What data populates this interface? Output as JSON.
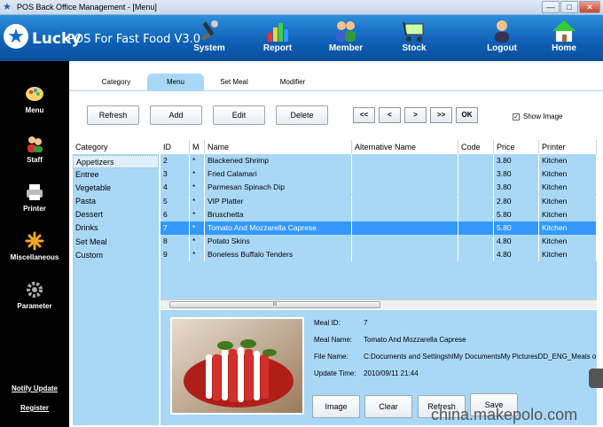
{
  "window": {
    "title": "POS Back Office Management - [Menu]"
  },
  "brand": {
    "name": "Lucky",
    "subtitle": "POS For Fast Food V3.0"
  },
  "nav": {
    "items": [
      {
        "label": "System",
        "icon": "system-icon"
      },
      {
        "label": "Report",
        "icon": "report-chart-icon"
      },
      {
        "label": "Member",
        "icon": "member-icon"
      },
      {
        "label": "Stock",
        "icon": "stock-cart-icon"
      },
      {
        "label": "Logout",
        "icon": "logout-icon"
      },
      {
        "label": "Home",
        "icon": "home-icon"
      }
    ]
  },
  "sidebar": {
    "items": [
      {
        "label": "Menu",
        "icon": "palette-icon"
      },
      {
        "label": "Staff",
        "icon": "staff-icon"
      },
      {
        "label": "Printer",
        "icon": "printer-icon"
      },
      {
        "label": "Miscellaneous",
        "icon": "misc-icon"
      },
      {
        "label": "Parameter",
        "icon": "gear-icon"
      }
    ],
    "links": {
      "notify": "Notify Update",
      "register": "Register"
    }
  },
  "tabs": [
    "Category",
    "Menu",
    "Set Meal",
    "Modifier"
  ],
  "active_tab": "Menu",
  "toolbar": {
    "refresh": "Refresh",
    "add": "Add",
    "edit": "Edit",
    "delete": "Delete",
    "first": "<<",
    "prev": "<",
    "next": ">",
    "last": ">>",
    "ok": "OK",
    "show_image": "Show Image"
  },
  "category": {
    "header": "Category",
    "items": [
      "Appetizers",
      "Entree",
      "Vegetable",
      "Pasta",
      "Dessert",
      "Drinks",
      "Set Meal",
      "Custom"
    ],
    "selected": "Appetizers"
  },
  "grid": {
    "columns": [
      "ID",
      "M",
      "Name",
      "Alternative Name",
      "Code",
      "Price",
      "Printer"
    ],
    "rows": [
      {
        "id": "2",
        "m": "*",
        "name": "Blackened Shrimp",
        "alt": "",
        "code": "",
        "price": "3.80",
        "printer": "Kitchen"
      },
      {
        "id": "3",
        "m": "*",
        "name": "Fried Calamari",
        "alt": "",
        "code": "",
        "price": "3.80",
        "printer": "Kitchen"
      },
      {
        "id": "4",
        "m": "*",
        "name": "Parmesan Spinach Dip",
        "alt": "",
        "code": "",
        "price": "3.80",
        "printer": "Kitchen"
      },
      {
        "id": "5",
        "m": "*",
        "name": "VIP Platter",
        "alt": "",
        "code": "",
        "price": "2.80",
        "printer": "Kitchen"
      },
      {
        "id": "6",
        "m": "*",
        "name": "Bruschetta",
        "alt": "",
        "code": "",
        "price": "5.80",
        "printer": "Kitchen"
      },
      {
        "id": "7",
        "m": "*",
        "name": "Tomato And Mozzarella Caprese",
        "alt": "",
        "code": "",
        "price": "5.80",
        "printer": "Kitchen"
      },
      {
        "id": "8",
        "m": "*",
        "name": "Potato Skins",
        "alt": "",
        "code": "",
        "price": "4.80",
        "printer": "Kitchen"
      },
      {
        "id": "9",
        "m": "*",
        "name": "Boneless Buffalo Tenders",
        "alt": "",
        "code": "",
        "price": "4.80",
        "printer": "Kitchen"
      }
    ],
    "selected_id": "7",
    "scroll_grip": "III"
  },
  "detail": {
    "meal_id_label": "Meal ID:",
    "meal_id": "7",
    "meal_name_label": "Meal Name:",
    "meal_name": "Tomato And Mozzarella Caprese",
    "file_name_label": "File Name:",
    "file_name": "C:Documents and SettingshlMy DocumentsMy PicturesDD_ENG_Meals o",
    "update_time_label": "Update Time:",
    "update_time": "2010/09/11 21:44",
    "buttons": {
      "image": "Image",
      "clear": "Clear",
      "refresh": "Refresh",
      "save": "Save"
    }
  },
  "watermark": "china.makepolo.com",
  "colors": {
    "topbar": "#0e5fb5",
    "panel": "#a9d8f7",
    "selection": "#3399ff",
    "sidebar": "#000000"
  }
}
